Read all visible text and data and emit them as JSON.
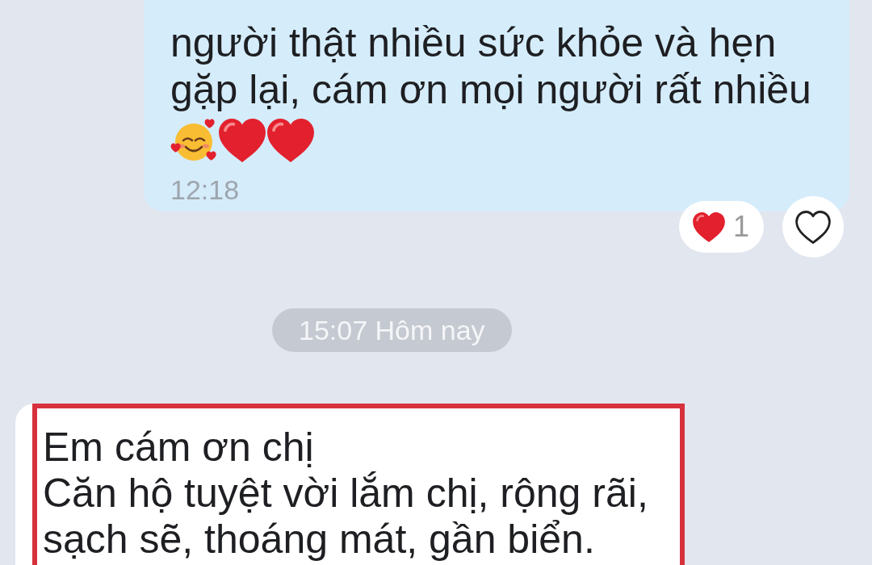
{
  "chat": [
    {
      "kind": "outgoing_message",
      "text": "người thật nhiều sức khỏe và hẹn gặp lại, cám ơn mọi người rất nhiều",
      "emojis": [
        {
          "kind": "smiling-face-with-hearts"
        },
        {
          "kind": "heart"
        },
        {
          "kind": "heart"
        }
      ],
      "time": "12:18",
      "reactions": [
        {
          "kind": "heart",
          "count": "1"
        }
      ],
      "liked": false
    },
    {
      "kind": "date_divider",
      "label": "15:07 Hôm nay"
    },
    {
      "kind": "incoming_message",
      "text": "Em cám ơn chị\nCăn hộ tuyệt vời lắm chị, rộng rãi, sạch sẽ, thoáng mát, gần biển.",
      "highlighted": true
    }
  ]
}
